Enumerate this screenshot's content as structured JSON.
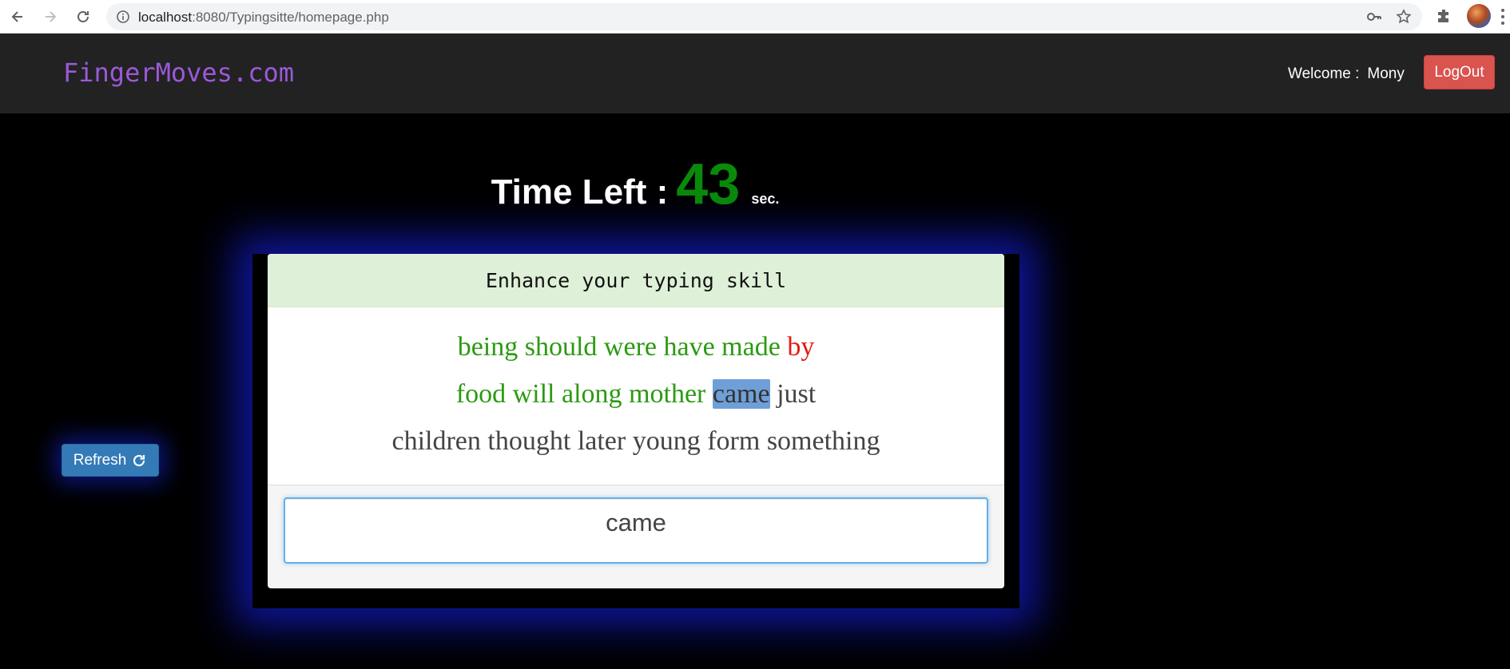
{
  "browser": {
    "url_host": "localhost",
    "url_path": ":8080/Typingsitte/homepage.php",
    "icons": [
      "back-icon",
      "forward-icon",
      "reload-icon",
      "info-icon",
      "key-icon",
      "star-icon",
      "extensions-icon",
      "profile-avatar",
      "menu-icon"
    ]
  },
  "navbar": {
    "brand": "FingerMoves.com",
    "welcome_label": "Welcome :",
    "user_name": "Mony",
    "logout_label": "LogOut"
  },
  "timer": {
    "label": "Time Left :",
    "value": "43",
    "unit": "sec."
  },
  "refresh": {
    "label": "Refresh",
    "icon": "refresh-icon"
  },
  "panel": {
    "heading": "Enhance your typing skill",
    "lines": [
      [
        {
          "text": "being",
          "state": "done"
        },
        {
          "text": "should",
          "state": "done"
        },
        {
          "text": "were",
          "state": "done"
        },
        {
          "text": "have",
          "state": "done"
        },
        {
          "text": "made",
          "state": "done"
        },
        {
          "text": "by",
          "state": "wrong"
        }
      ],
      [
        {
          "text": "food",
          "state": "done"
        },
        {
          "text": "will",
          "state": "done"
        },
        {
          "text": "along",
          "state": "done"
        },
        {
          "text": "mother",
          "state": "done"
        },
        {
          "text": "came",
          "state": "current"
        },
        {
          "text": "just",
          "state": "pending"
        }
      ],
      [
        {
          "text": "children",
          "state": "pending"
        },
        {
          "text": "thought",
          "state": "pending"
        },
        {
          "text": "later",
          "state": "pending"
        },
        {
          "text": "young",
          "state": "pending"
        },
        {
          "text": "form",
          "state": "pending"
        },
        {
          "text": "something",
          "state": "pending"
        }
      ]
    ],
    "input_value": "came"
  },
  "colors": {
    "done": "#2b9a12",
    "wrong": "#e41a12",
    "current_highlight": "#6f9fd8",
    "timer": "#0a8a0a",
    "brand": "#9b59d9",
    "logout": "#d9534f",
    "refresh": "#337ab7"
  }
}
